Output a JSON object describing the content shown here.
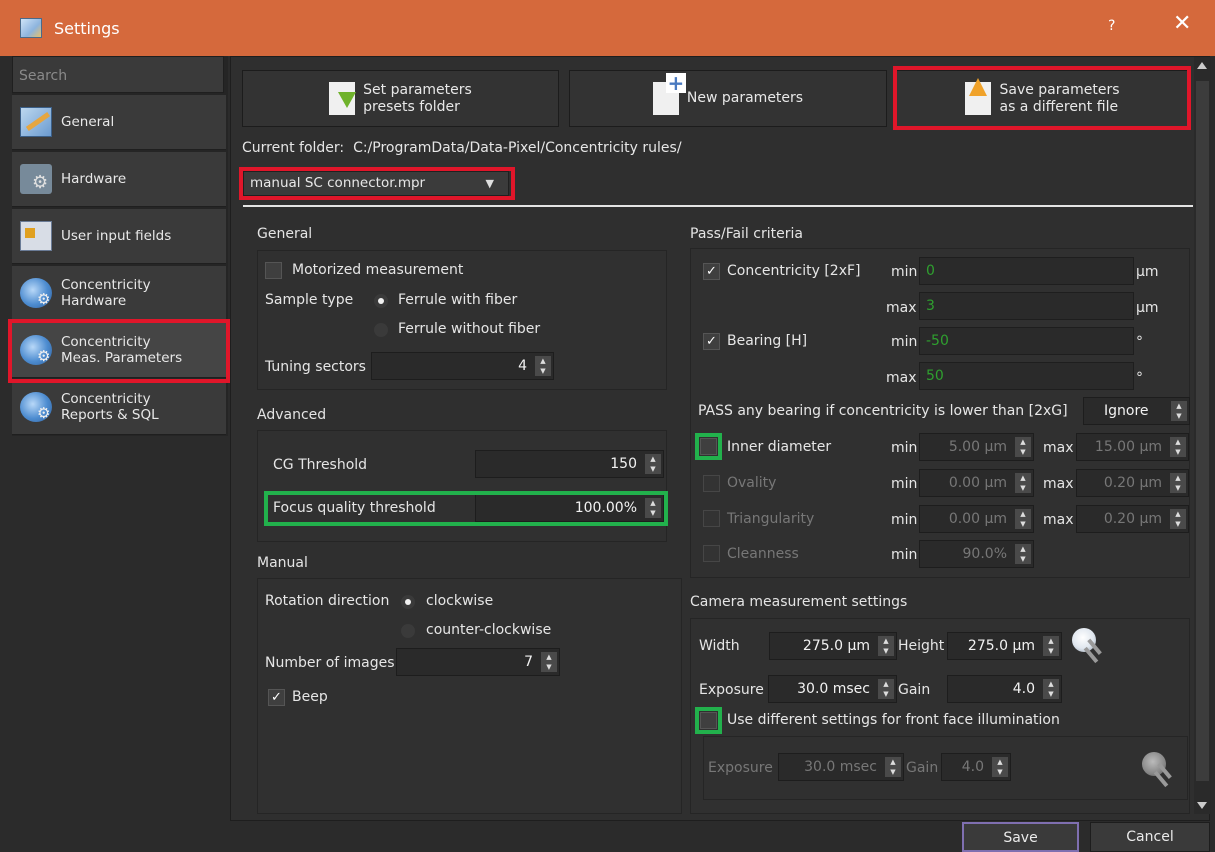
{
  "window": {
    "title": "Settings",
    "help": "?",
    "close": "✕"
  },
  "sidebar": {
    "search_placeholder": "Search",
    "items": [
      {
        "label": "General"
      },
      {
        "label": "Hardware"
      },
      {
        "label": "User input fields"
      },
      {
        "label": "Concentricity\nHardware"
      },
      {
        "label": "Concentricity\nMeas. Parameters"
      },
      {
        "label": "Concentricity\nReports & SQL"
      }
    ]
  },
  "toolbar": {
    "set_folder": "Set parameters\npresets folder",
    "new_params": "New parameters",
    "save_as": "Save parameters\nas a different file"
  },
  "folder": {
    "label": "Current folder:",
    "path": "C:/ProgramData/Data-Pixel/Concentricity rules/",
    "selected_file": "manual SC connector.mpr"
  },
  "general": {
    "title": "General",
    "motorized": "Motorized measurement",
    "sample_type_label": "Sample type",
    "opt_with_fiber": "Ferrule with fiber",
    "opt_without_fiber": "Ferrule without fiber",
    "tuning_sectors_label": "Tuning sectors",
    "tuning_sectors_value": "4"
  },
  "advanced": {
    "title": "Advanced",
    "cg_threshold_label": "CG Threshold",
    "cg_threshold_value": "150",
    "focus_label": "Focus quality threshold",
    "focus_value": "100.00%"
  },
  "manual": {
    "title": "Manual",
    "rotation_label": "Rotation direction",
    "opt_clockwise": "clockwise",
    "opt_ccw": "counter-clockwise",
    "images_label": "Number of images",
    "images_value": "7",
    "beep": "Beep"
  },
  "passfail": {
    "title": "Pass/Fail criteria",
    "concentricity": "Concentricity [2xF]",
    "conc_min": "0",
    "conc_max": "3",
    "bearing": "Bearing [H]",
    "bear_min": "-50",
    "bear_max": "50",
    "min": "min",
    "max": "max",
    "unit_um": "µm",
    "unit_deg": "°",
    "pass_any": "PASS any bearing if concentricity is lower than [2xG]",
    "pass_any_value": "Ignore",
    "inner_diameter": "Inner diameter",
    "id_min": "5.00 µm",
    "id_max": "15.00 µm",
    "ovality": "Ovality",
    "ov_min": "0.00 µm",
    "ov_max": "0.20 µm",
    "triangularity": "Triangularity",
    "tr_min": "0.00 µm",
    "tr_max": "0.20 µm",
    "cleanness": "Cleanness",
    "cl_min": "90.0%"
  },
  "camera": {
    "title": "Camera measurement settings",
    "width_label": "Width",
    "width_value": "275.0 µm",
    "height_label": "Height",
    "height_value": "275.0 µm",
    "exposure_label": "Exposure",
    "exposure_value": "30.0 msec",
    "gain_label": "Gain",
    "gain_value": "4.0",
    "front_face": "Use different settings for front face illumination",
    "ff_exposure_label": "Exposure",
    "ff_exposure_value": "30.0 msec",
    "ff_gain_label": "Gain",
    "ff_gain_value": "4.0"
  },
  "footer": {
    "save": "Save",
    "cancel": "Cancel"
  },
  "colors": {
    "titlebar": "#d5693c",
    "highlight_red": "#e0162a",
    "highlight_green": "#22b14c",
    "value_green": "#2fa02f"
  }
}
